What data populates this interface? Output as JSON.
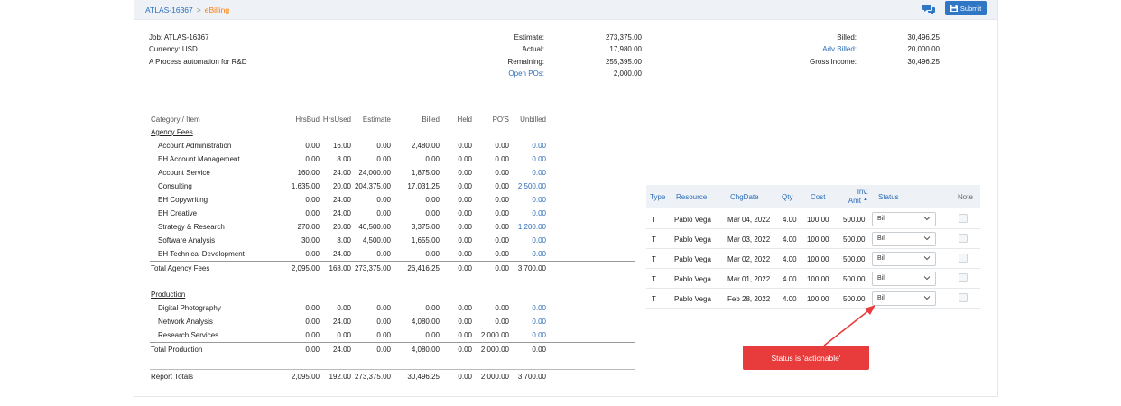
{
  "breadcrumb": {
    "root": "ATLAS-16367",
    "separator": ">",
    "current": "eBilling"
  },
  "toolbar": {
    "chat_icon": "comments-icon",
    "submit_label": "Submit",
    "accent": "#2f76c4"
  },
  "job": {
    "job_line": "Job: ATLAS-16367",
    "currency_line": "Currency: USD",
    "description": "A Process automation for R&D"
  },
  "summary": {
    "estimate_label": "Estimate:",
    "estimate": "273,375.00",
    "actual_label": "Actual:",
    "actual": "17,980.00",
    "remaining_label": "Remaining:",
    "remaining": "255,395.00",
    "open_pos_label": "Open POs:",
    "open_pos": "2,000.00",
    "billed_label": "Billed:",
    "billed": "30,496.25",
    "adv_billed_label": "Adv Billed:",
    "adv_billed": "20,000.00",
    "gross_income_label": "Gross Income:",
    "gross_income": "30,496.25"
  },
  "left_table": {
    "headers": [
      "Category / Item",
      "HrsBud",
      "HrsUsed",
      "Estimate",
      "Billed",
      "Held",
      "PO'S",
      "Unbilled"
    ],
    "agency_title": "Agency Fees",
    "agency_rows": [
      [
        "Account Administration",
        "0.00",
        "16.00",
        "0.00",
        "2,480.00",
        "0.00",
        "0.00",
        "0.00"
      ],
      [
        "EH Account Management",
        "0.00",
        "8.00",
        "0.00",
        "0.00",
        "0.00",
        "0.00",
        "0.00"
      ],
      [
        "Account Service",
        "160.00",
        "24.00",
        "24,000.00",
        "1,875.00",
        "0.00",
        "0.00",
        "0.00"
      ],
      [
        "Consulting",
        "1,635.00",
        "20.00",
        "204,375.00",
        "17,031.25",
        "0.00",
        "0.00",
        "2,500.00"
      ],
      [
        "EH Copywriting",
        "0.00",
        "24.00",
        "0.00",
        "0.00",
        "0.00",
        "0.00",
        "0.00"
      ],
      [
        "EH Creative",
        "0.00",
        "24.00",
        "0.00",
        "0.00",
        "0.00",
        "0.00",
        "0.00"
      ],
      [
        "Strategy & Research",
        "270.00",
        "20.00",
        "40,500.00",
        "3,375.00",
        "0.00",
        "0.00",
        "1,200.00"
      ],
      [
        "Software Analysis",
        "30.00",
        "8.00",
        "4,500.00",
        "1,655.00",
        "0.00",
        "0.00",
        "0.00"
      ],
      [
        "EH Technical Development",
        "0.00",
        "24.00",
        "0.00",
        "0.00",
        "0.00",
        "0.00",
        "0.00"
      ]
    ],
    "agency_total": [
      "Total Agency Fees",
      "2,095.00",
      "168.00",
      "273,375.00",
      "26,416.25",
      "0.00",
      "0.00",
      "3,700.00"
    ],
    "production_title": "Production",
    "production_rows": [
      [
        "Digital Photography",
        "0.00",
        "0.00",
        "0.00",
        "0.00",
        "0.00",
        "0.00",
        "0.00"
      ],
      [
        "Network Analysis",
        "0.00",
        "24.00",
        "0.00",
        "4,080.00",
        "0.00",
        "0.00",
        "0.00"
      ],
      [
        "Research Services",
        "0.00",
        "0.00",
        "0.00",
        "0.00",
        "0.00",
        "2,000.00",
        "0.00"
      ]
    ],
    "production_total": [
      "Total Production",
      "0.00",
      "24.00",
      "0.00",
      "4,080.00",
      "0.00",
      "2,000.00",
      "0.00"
    ],
    "report_totals": [
      "Report Totals",
      "2,095.00",
      "192.00",
      "273,375.00",
      "30,496.25",
      "0.00",
      "2,000.00",
      "3,700.00"
    ]
  },
  "right_table": {
    "headers": {
      "type": "Type",
      "resource": "Resource",
      "chgdate": "ChgDate",
      "qty": "Qty",
      "cost": "Cost",
      "inv_amt_1": "Inv.",
      "inv_amt_2": "Amt",
      "status": "Status",
      "note": "Note"
    },
    "sort_icon": "sort-asc-icon",
    "rows": [
      {
        "type": "T",
        "resource": "Pablo Vega",
        "chgdate": "Mar 04, 2022",
        "qty": "4.00",
        "cost": "100.00",
        "inv_amt": "500.00",
        "status": "Bill"
      },
      {
        "type": "T",
        "resource": "Pablo Vega",
        "chgdate": "Mar 03, 2022",
        "qty": "4.00",
        "cost": "100.00",
        "inv_amt": "500.00",
        "status": "Bill"
      },
      {
        "type": "T",
        "resource": "Pablo Vega",
        "chgdate": "Mar 02, 2022",
        "qty": "4.00",
        "cost": "100.00",
        "inv_amt": "500.00",
        "status": "Bill"
      },
      {
        "type": "T",
        "resource": "Pablo Vega",
        "chgdate": "Mar 01, 2022",
        "qty": "4.00",
        "cost": "100.00",
        "inv_amt": "500.00",
        "status": "Bill"
      },
      {
        "type": "T",
        "resource": "Pablo Vega",
        "chgdate": "Feb 28, 2022",
        "qty": "4.00",
        "cost": "100.00",
        "inv_amt": "500.00",
        "status": "Bill"
      }
    ]
  },
  "annotation": {
    "text": "Status is 'actionable'",
    "color": "#e83b3b"
  }
}
